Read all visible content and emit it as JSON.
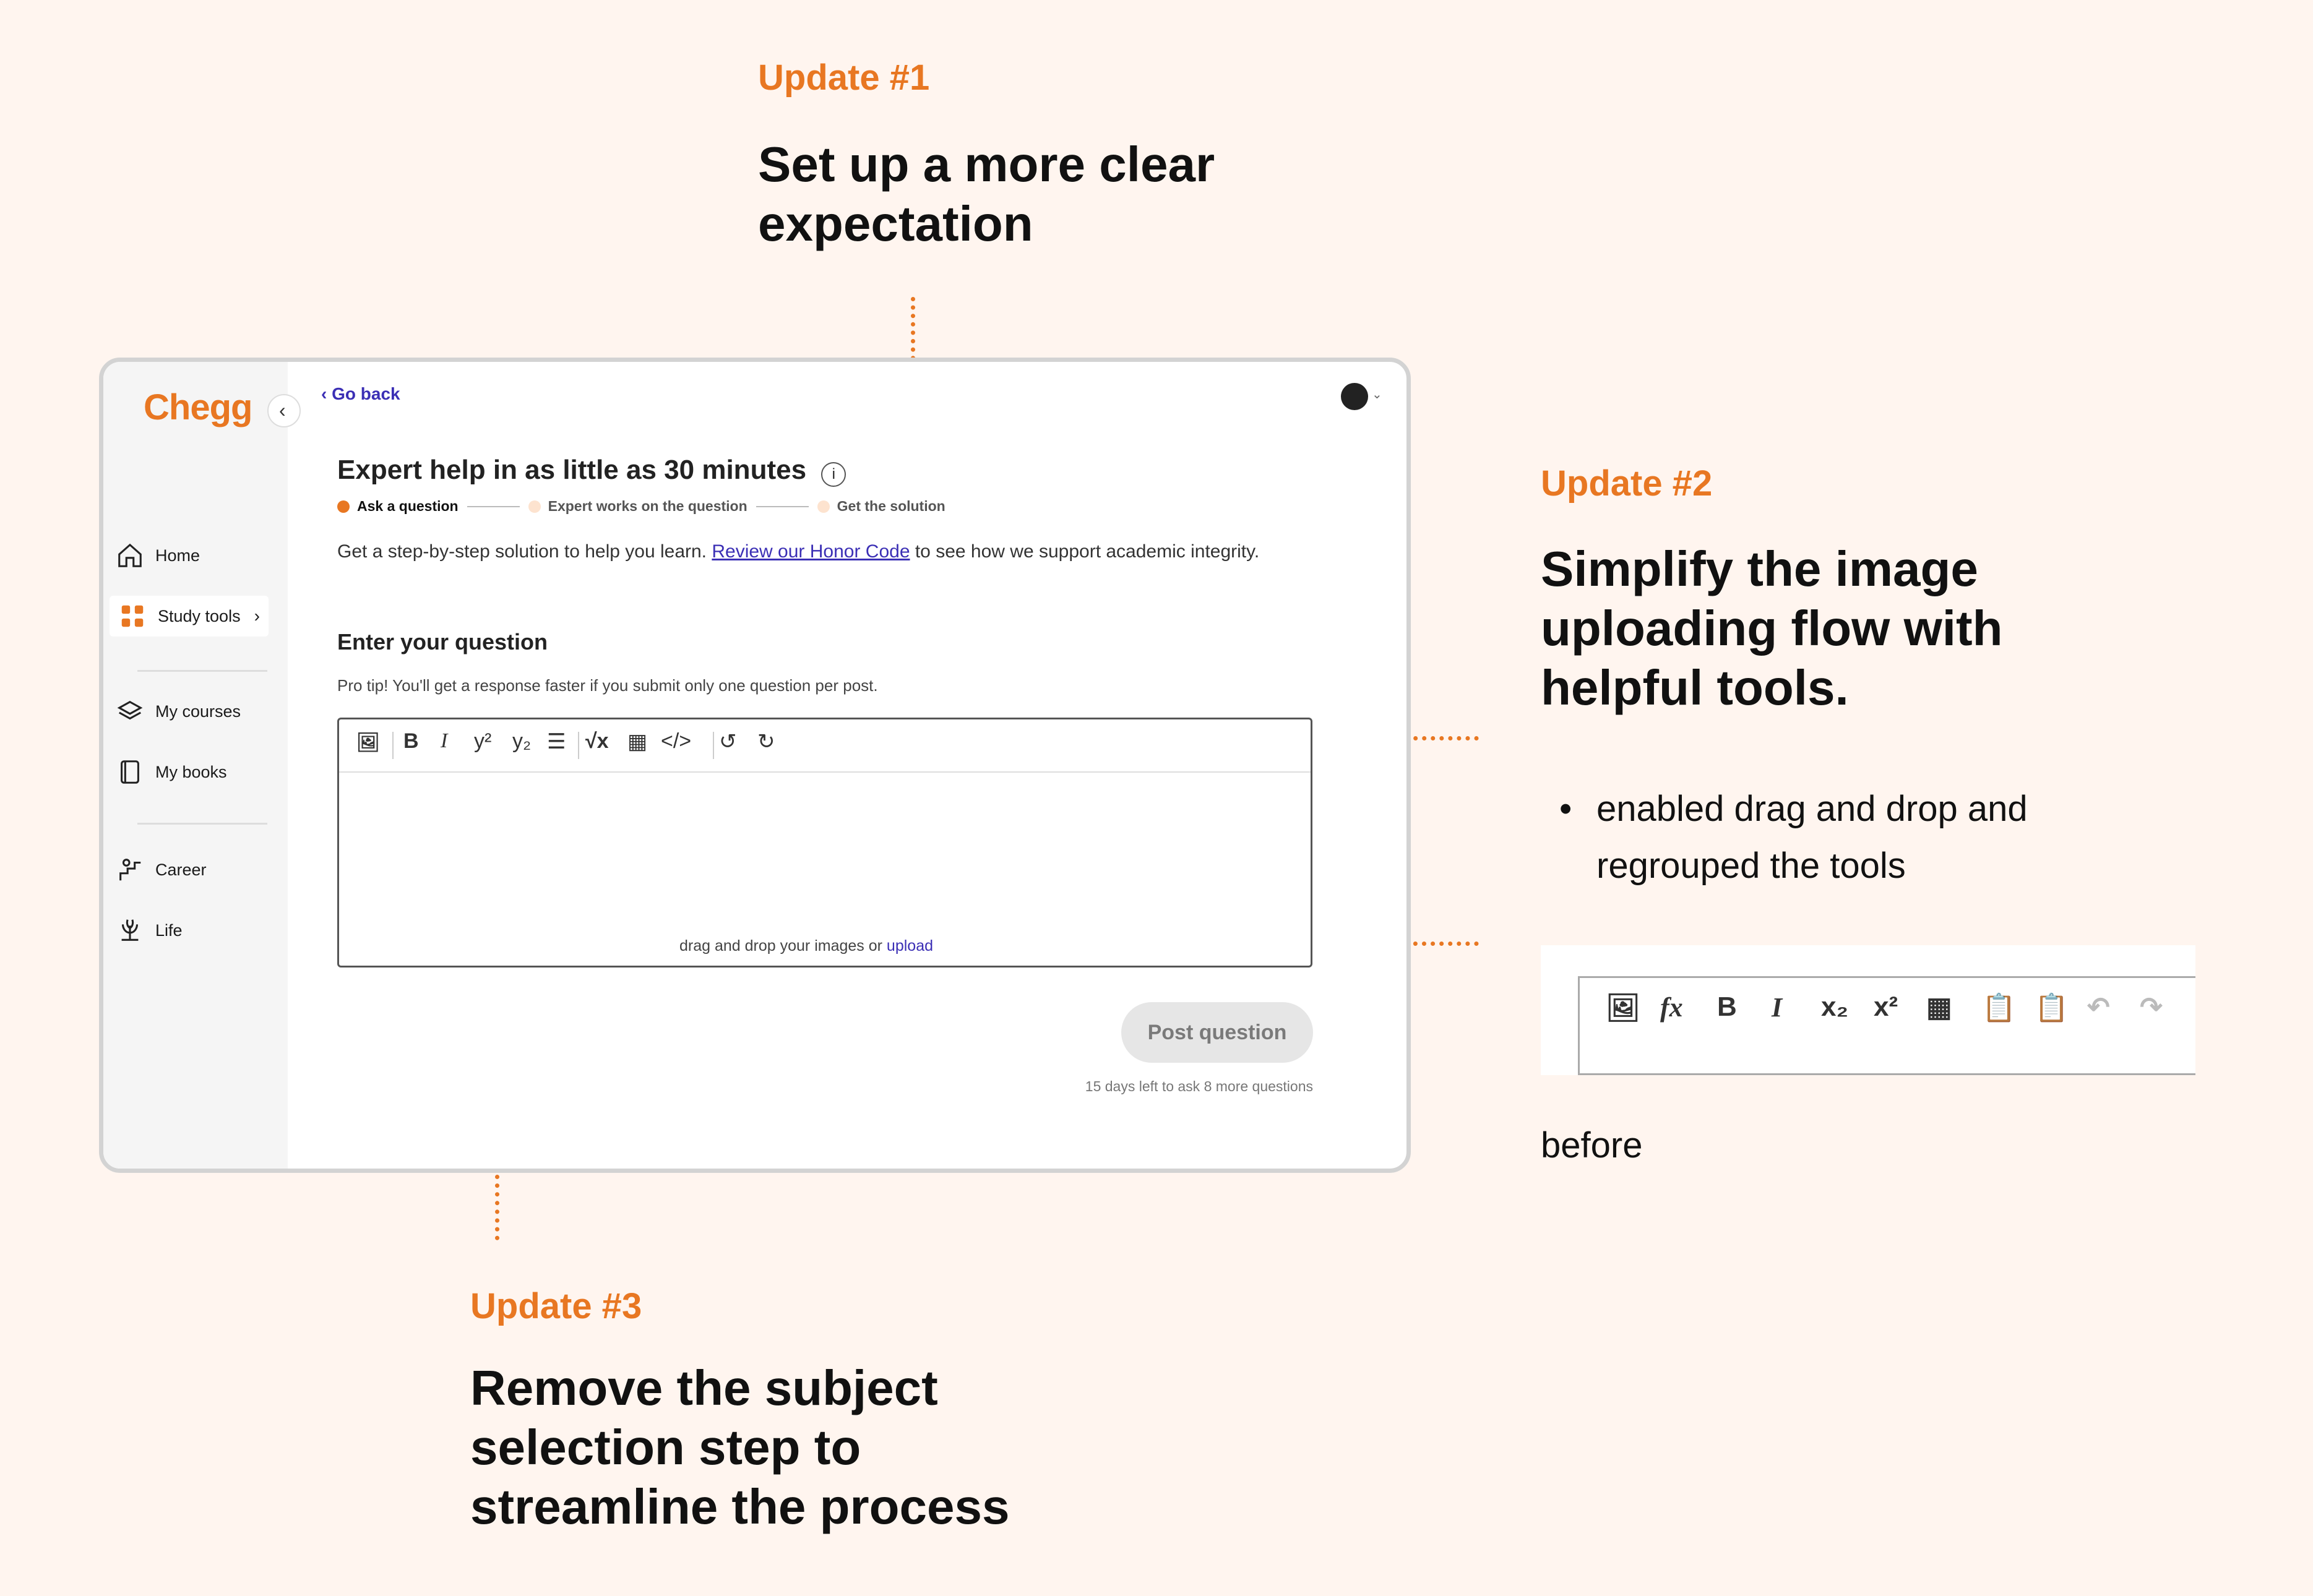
{
  "updates": {
    "u1": {
      "label": "Update #1",
      "title": "Set up a more clear expectation"
    },
    "u2": {
      "label": "Update #2",
      "title": "Simplify the image uploading flow with helpful tools.",
      "bullet": "enabled drag and drop and regrouped the tools",
      "caption": "before"
    },
    "u3": {
      "label": "Update #3",
      "title": "Remove the subject selection step to streamline the process"
    }
  },
  "app": {
    "logo": "Chegg",
    "go_back": "‹ Go back",
    "nav": [
      {
        "label": "Home",
        "icon": "home-icon"
      },
      {
        "label": "Study tools",
        "icon": "grid-icon"
      },
      {
        "label": "My courses",
        "icon": "layers-icon"
      },
      {
        "label": "My books",
        "icon": "book-icon"
      },
      {
        "label": "Career",
        "icon": "career-icon"
      },
      {
        "label": "Life",
        "icon": "life-icon"
      }
    ],
    "heading": "Expert help in as little as 30 minutes",
    "steps": [
      "Ask a question",
      "Expert works on the question",
      "Get the solution"
    ],
    "intro_before": "Get a step-by-step solution to help you learn. ",
    "honor_link": "Review our Honor Code",
    "intro_after": " to see how we support academic integrity.",
    "question_heading": "Enter your question",
    "pro_tip": "Pro tip! You'll get a response faster if you submit only one question per post.",
    "drop_text": "drag and drop your images or ",
    "upload_link": "upload",
    "post_button": "Post question",
    "quota": "15 days left to ask 8 more questions"
  },
  "colors": {
    "accent": "#e87722",
    "link": "#3b2fb5",
    "background": "#fff5ef"
  }
}
